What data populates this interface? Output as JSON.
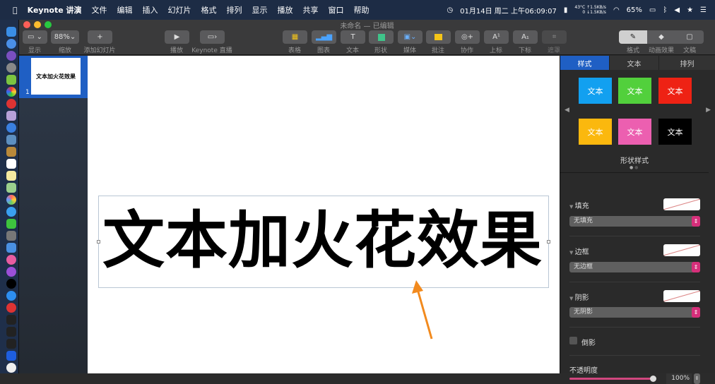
{
  "menubar": {
    "app": "Keynote 讲演",
    "items": [
      "文件",
      "编辑",
      "插入",
      "幻灯片",
      "格式",
      "排列",
      "显示",
      "播放",
      "共享",
      "窗口",
      "帮助"
    ],
    "datetime": "01月14日 周二 上午06:09:07",
    "temp": "43°C",
    "net_up": "↑1.5KB/s",
    "net_zero": "0",
    "net_down": "↓1.5KB/s",
    "battery": "65%"
  },
  "window": {
    "title": "未命名 — 已编辑"
  },
  "toolbar": {
    "view": "显示",
    "zoom_value": "88%",
    "zoom": "缩放",
    "add_slide": "添加幻灯片",
    "play": "播放",
    "live": "Keynote 直播",
    "table": "表格",
    "chart": "图表",
    "text": "文本",
    "shape": "形状",
    "media": "媒体",
    "comment": "批注",
    "collaborate": "协作",
    "superscript": "上标",
    "subscript": "下标",
    "mask": "遮罩",
    "format": "格式",
    "animate": "动画效果",
    "document": "文稿"
  },
  "navigator": {
    "slide_number": "1",
    "slide_text": "文本加火花效果"
  },
  "slide": {
    "text": "文本加火花效果"
  },
  "inspector": {
    "tabs": [
      "样式",
      "文本",
      "排列"
    ],
    "styles": [
      {
        "label": "文本",
        "color": "#12a0f0"
      },
      {
        "label": "文本",
        "color": "#52d03c"
      },
      {
        "label": "文本",
        "color": "#ee2214"
      },
      {
        "label": "文本",
        "color": "#fbb80e"
      },
      {
        "label": "文本",
        "color": "#ec5fb0"
      },
      {
        "label": "文本",
        "color": "#000000"
      }
    ],
    "styles_label": "形状样式",
    "fill": {
      "label": "填充",
      "value": "无填充"
    },
    "border": {
      "label": "边框",
      "value": "无边框"
    },
    "shadow": {
      "label": "阴影",
      "value": "无阴影"
    },
    "reflection": "倒影",
    "opacity": {
      "label": "不透明度",
      "value": "100%",
      "fraction": 1.0
    }
  },
  "accent": "#d62f7a"
}
